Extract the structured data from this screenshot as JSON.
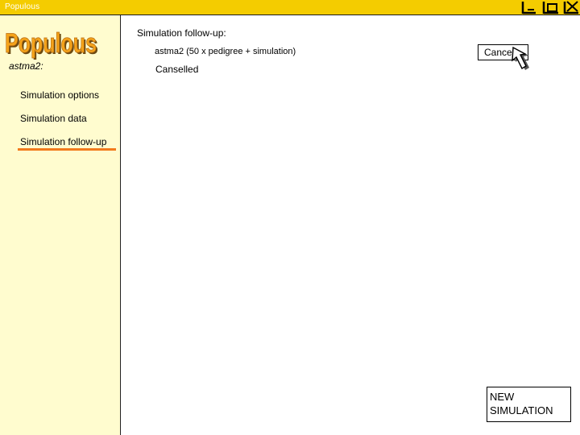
{
  "window": {
    "title": "Populous",
    "controls": [
      "minimize-icon",
      "maximize-icon",
      "close-icon"
    ]
  },
  "sidebar": {
    "logo_text": "Populous",
    "simulation_name": "astma2:",
    "nav": [
      {
        "label": "Simulation options",
        "active": false
      },
      {
        "label": "Simulation data",
        "active": false
      },
      {
        "label": "Simulation follow-up",
        "active": true
      }
    ]
  },
  "main": {
    "heading": "Simulation follow-up:",
    "simulation_description": "astma2 (50 x pedigree + simulation)",
    "status": "Canselled",
    "cancel_label": "Cancel",
    "new_simulation_label": "NEW SIMULATION"
  },
  "colors": {
    "titlebar": "#f4cc00",
    "sidebar": "#fffccf",
    "logo_fill": "#f4a31a",
    "active_underline": "#f27b1c"
  }
}
